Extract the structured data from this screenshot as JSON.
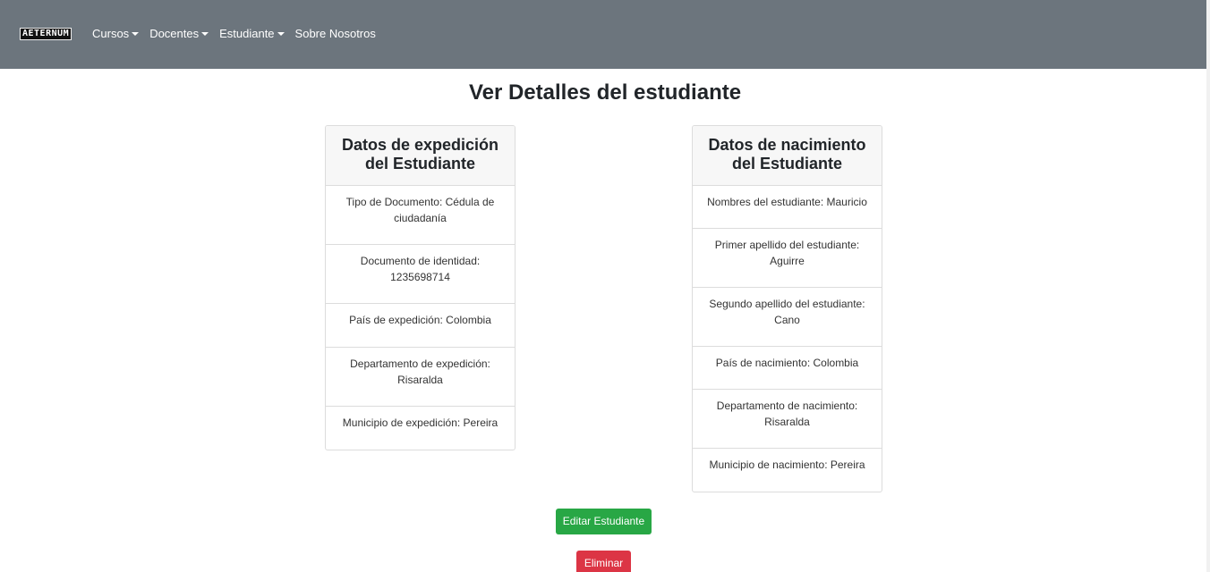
{
  "navbar": {
    "brand": "AETERNUM",
    "items": [
      {
        "label": "Cursos",
        "dropdown": true
      },
      {
        "label": "Docentes",
        "dropdown": true
      },
      {
        "label": "Estudiante",
        "dropdown": true
      },
      {
        "label": "Sobre Nosotros",
        "dropdown": false
      }
    ]
  },
  "page": {
    "title": "Ver Detalles del estudiante"
  },
  "expedition_card": {
    "title_line1": "Datos de expedición",
    "title_line2": "del Estudiante",
    "items": [
      "Tipo de Documento: Cédula de ciudadanía",
      "Documento de identidad: 1235698714",
      "País de expedición: Colombia",
      "Departamento de expedición: Risaralda",
      "Municipio de expedición: Pereira"
    ]
  },
  "birth_card": {
    "title_line1": "Datos de nacimiento",
    "title_line2": "del Estudiante",
    "items": [
      "Nombres del estudiante: Mauricio",
      "Primer apellido del estudiante: Aguirre",
      "Segundo apellido del estudiante: Cano",
      "País de nacimiento: Colombia",
      "Departamento de nacimiento: Risaralda",
      "Municipio de nacimiento: Pereira"
    ]
  },
  "actions": {
    "edit_label": "Editar Estudiante",
    "delete_label": "Eliminar"
  },
  "colors": {
    "navbar": "#6c757d",
    "edit_button": "#28a745",
    "delete_button": "#dc3545"
  }
}
